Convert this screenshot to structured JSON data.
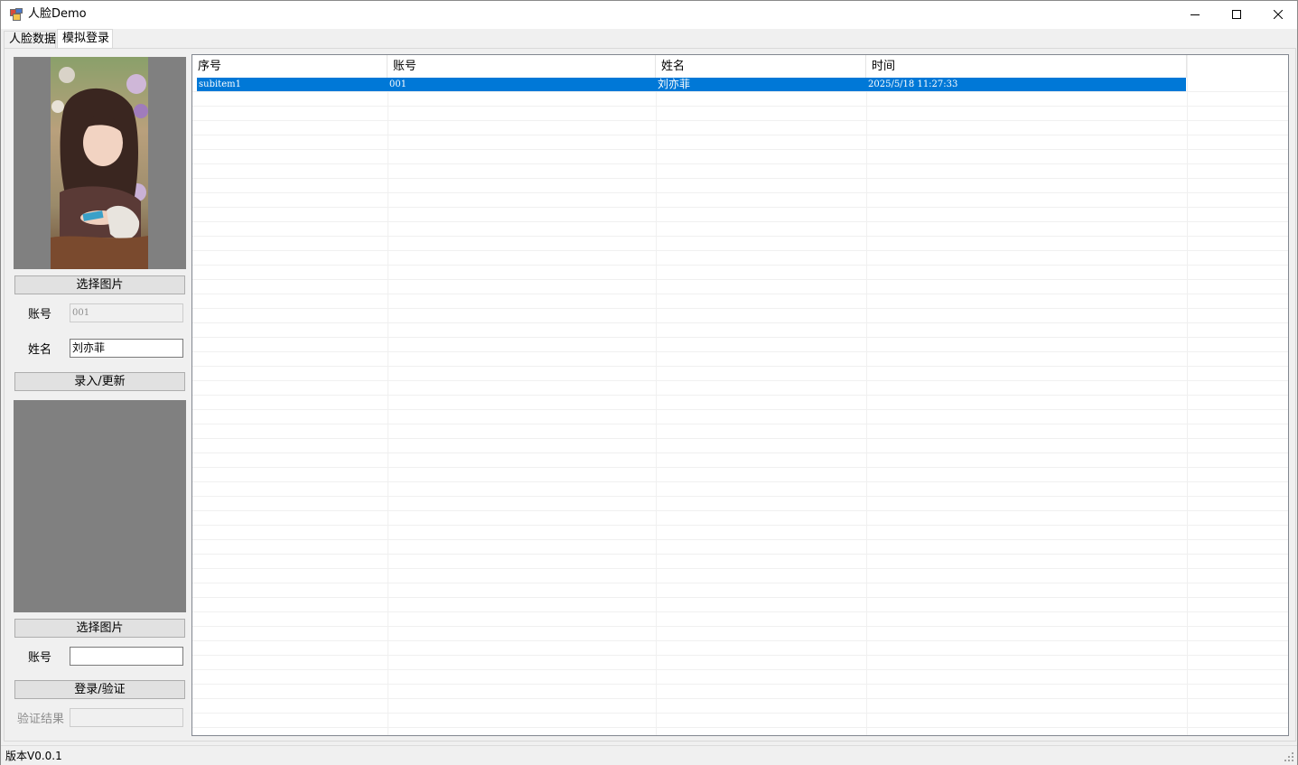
{
  "window": {
    "title": "人脸Demo"
  },
  "tabs": [
    {
      "label": "人脸数据"
    },
    {
      "label": "模拟登录"
    }
  ],
  "register": {
    "choose_image_label": "选择图片",
    "account_label": "账号",
    "account_value": "001",
    "name_label": "姓名",
    "name_value": "刘亦菲",
    "submit_label": "录入/更新"
  },
  "login": {
    "choose_image_label": "选择图片",
    "account_label": "账号",
    "account_value": "",
    "submit_label": "登录/验证",
    "result_label": "验证结果",
    "result_value": ""
  },
  "table": {
    "columns": [
      "序号",
      "账号",
      "姓名",
      "时间"
    ],
    "rows": [
      [
        "subitem1",
        "001",
        "刘亦菲",
        "2025/5/18 11:27:33"
      ]
    ]
  },
  "status": {
    "version_text": "版本V0.0.1"
  },
  "colors": {
    "selection": "#0078d7",
    "picture_bg": "#808080",
    "window_bg": "#f0f0f0"
  }
}
